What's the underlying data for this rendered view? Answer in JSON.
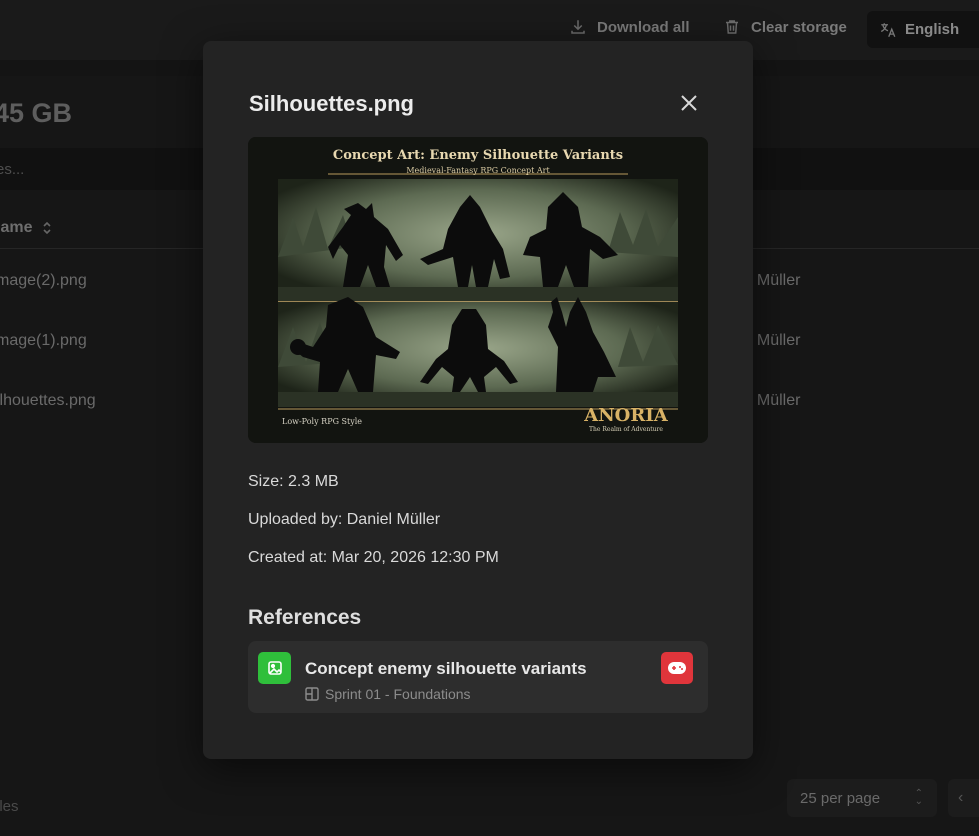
{
  "topbar": {
    "download_all": "Download all",
    "clear_storage": "Clear storage",
    "language": "English"
  },
  "storage": {
    "size": "45 GB",
    "search_placeholder": "es..."
  },
  "table": {
    "header_name": "lame",
    "rows": [
      {
        "name": "mage(2).png",
        "owner": "el Müller"
      },
      {
        "name": "mage(1).png",
        "owner": "el Müller"
      },
      {
        "name": "ilhouettes.png",
        "owner": "el Müller"
      }
    ]
  },
  "footer": {
    "files_label": "iles",
    "per_page": "25 per page"
  },
  "modal": {
    "title": "Silhouettes.png",
    "preview": {
      "heading": "Concept Art: Enemy Silhouette Variants",
      "subheading": "Medieval-Fantasy RPG Concept Art",
      "style_label": "Low-Poly RPG Style",
      "logo_text": "ANORIA",
      "logo_tagline": "The Realm of Adventure"
    },
    "size": "Size: 2.3 MB",
    "uploaded_by": "Uploaded by: Daniel Müller",
    "created_at": "Created at: Mar 20, 2026 12:30 PM",
    "references_title": "References",
    "reference": {
      "title": "Concept enemy silhouette variants",
      "subtitle": "Sprint 01 - Foundations"
    }
  },
  "colors": {
    "image_icon": "#2fbf3b",
    "game_icon": "#e0353b"
  }
}
